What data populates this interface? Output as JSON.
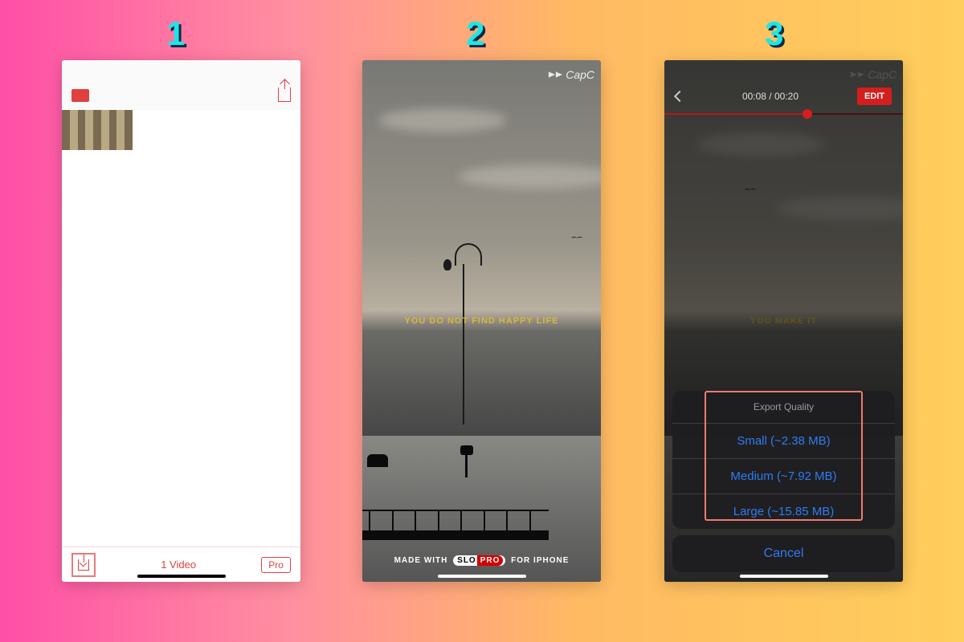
{
  "steps": {
    "one": "1",
    "two": "2",
    "three": "3"
  },
  "screen1": {
    "video_count": "1 Video",
    "pro_label": "Pro"
  },
  "screen2": {
    "watermark": "CapC",
    "caption": "YOU DO NOT FIND HAPPY LIFE",
    "madewith_pre": "MADE WITH",
    "madewith_brand_a": "SLO",
    "madewith_brand_b": "PRO",
    "madewith_post": "FOR IPHONE"
  },
  "screen3": {
    "watermark": "CapC",
    "timecode": "00:08 / 00:20",
    "edit": "EDIT",
    "caption": "YOU MAKE IT",
    "sheet_title": "Export Quality",
    "opt_small": "Small (~2.38 MB)",
    "opt_medium": "Medium (~7.92 MB)",
    "opt_large": "Large (~15.85 MB)",
    "cancel": "Cancel"
  }
}
